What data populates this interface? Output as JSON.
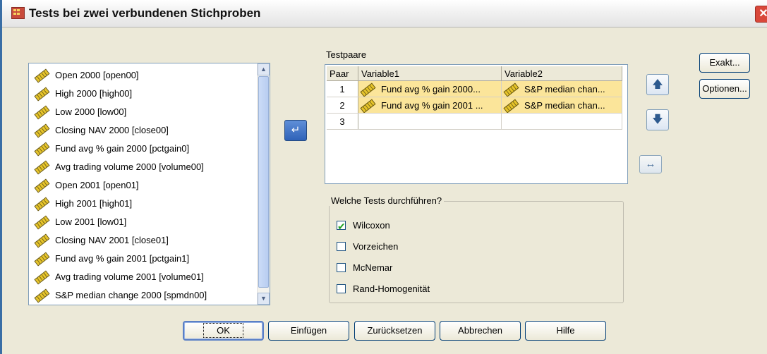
{
  "window": {
    "title": "Tests bei zwei verbundenen Stichproben"
  },
  "variables": [
    "Open 2000 [open00]",
    "High 2000 [high00]",
    "Low 2000 [low00]",
    "Closing NAV 2000 [close00]",
    "Fund avg % gain 2000 [pctgain0]",
    "Avg trading volume 2000 [volume00]",
    "Open 2001 [open01]",
    "High 2001 [high01]",
    "Low 2001 [low01]",
    "Closing NAV 2001 [close01]",
    "Fund avg % gain 2001 [pctgain1]",
    "Avg trading volume 2001 [volume01]",
    "S&P median change 2000 [spmdn00]"
  ],
  "testpairs": {
    "label": "Testpaare",
    "headers": [
      "Paar",
      "Variable1",
      "Variable2"
    ],
    "rows": [
      {
        "n": "1",
        "v1": "Fund avg % gain 2000...",
        "v2": "S&P median chan..."
      },
      {
        "n": "2",
        "v1": "Fund avg % gain 2001 ...",
        "v2": "S&P median chan..."
      },
      {
        "n": "3",
        "v1": "",
        "v2": ""
      }
    ]
  },
  "tests": {
    "title": "Welche Tests durchführen?",
    "options": [
      {
        "label": "Wilcoxon",
        "checked": true
      },
      {
        "label": "Vorzeichen",
        "checked": false
      },
      {
        "label": "McNemar",
        "checked": false
      },
      {
        "label": "Rand-Homogenität",
        "checked": false
      }
    ]
  },
  "side_buttons": {
    "exact": "Exakt...",
    "options": "Optionen..."
  },
  "footer": {
    "ok": "OK",
    "paste": "Einfügen",
    "reset": "Zurücksetzen",
    "cancel": "Abbrechen",
    "help": "Hilfe"
  },
  "icons": {
    "move": "arrow-left-icon",
    "up": "arrow-up-icon",
    "down": "arrow-down-icon",
    "swap": "swap-icon",
    "variable": "scale-ruler-icon"
  }
}
